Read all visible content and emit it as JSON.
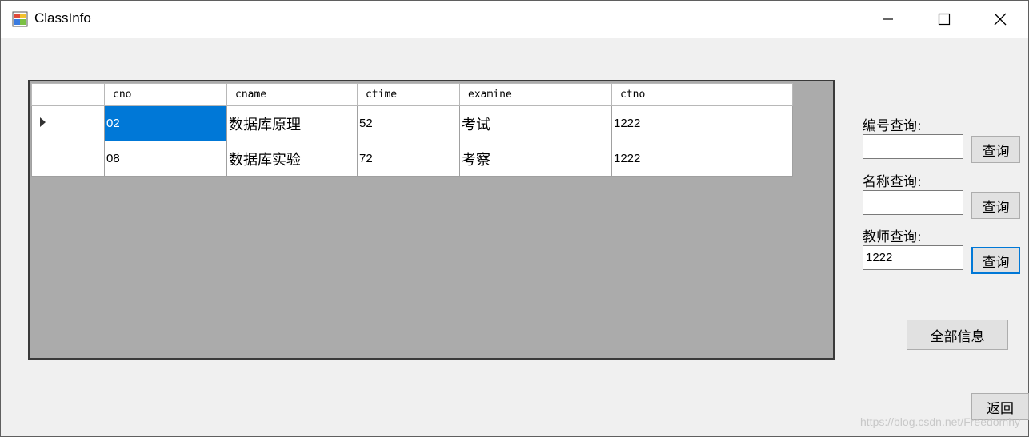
{
  "window": {
    "title": "ClassInfo"
  },
  "grid": {
    "columns": [
      "cno",
      "cname",
      "ctime",
      "examine",
      "ctno"
    ],
    "rows": [
      [
        "02",
        "数据库原理",
        "52",
        "考试",
        "1222"
      ],
      [
        "08",
        "数据库实验",
        "72",
        "考察",
        "1222"
      ]
    ]
  },
  "search": {
    "id_label": "编号查询:",
    "id_value": "",
    "name_label": "名称查询:",
    "name_value": "",
    "teacher_label": "教师查询:",
    "teacher_value": "1222",
    "query_button": "查询"
  },
  "actions": {
    "all_info": "全部信息",
    "back": "返回"
  },
  "watermark": "https://blog.csdn.net/Freedomhy",
  "colors": {
    "selection": "#0078d7",
    "grid_background": "#ababab",
    "focus_border": "#0078d7"
  }
}
